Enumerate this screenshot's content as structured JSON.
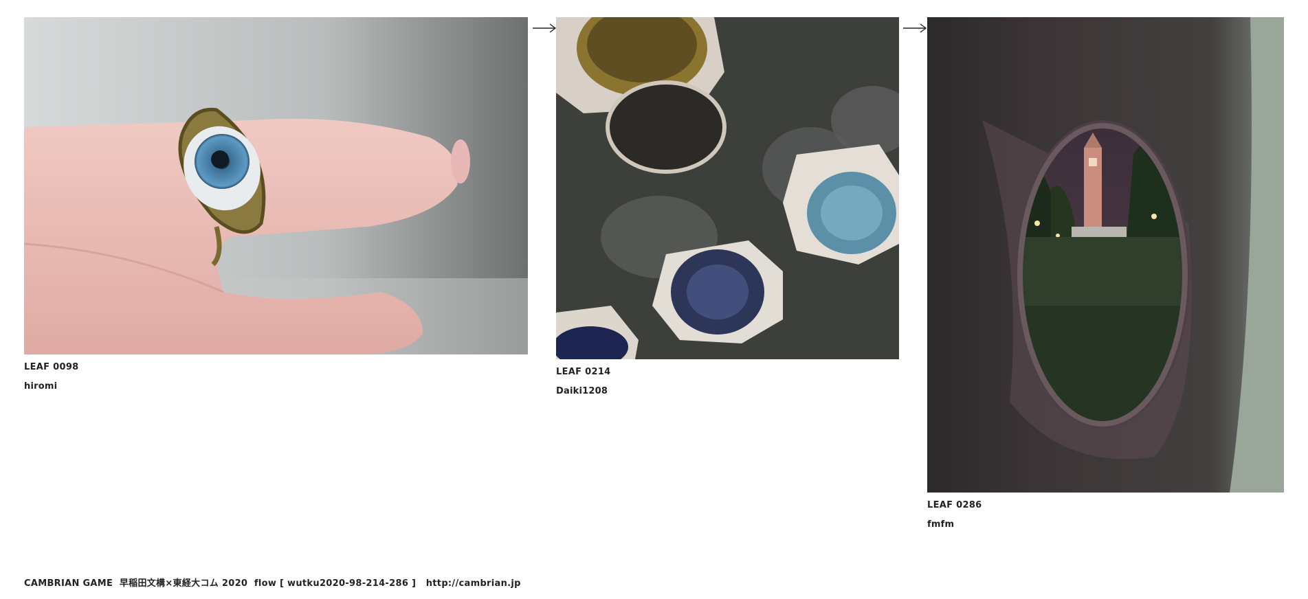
{
  "leaves": [
    {
      "id_label": "LEAF 0098",
      "author": "hiromi",
      "photo_subject": "eye-ring-on-finger"
    },
    {
      "id_label": "LEAF 0214",
      "author": "Daiki1208",
      "photo_subject": "colored-lens-filters"
    },
    {
      "id_label": "LEAF 0286",
      "author": "fmfm",
      "photo_subject": "night-campus-through-hole"
    }
  ],
  "arrows": [
    "right-arrow-icon",
    "right-arrow-icon"
  ],
  "footer": {
    "credit": "CAMBRIAN GAME  早稲田文構×東経大コム 2020  flow [ wutku2020-98-214-286 ]",
    "url": "http://cambrian.jp"
  },
  "colors": {
    "text": "#222222",
    "background": "#ffffff"
  }
}
